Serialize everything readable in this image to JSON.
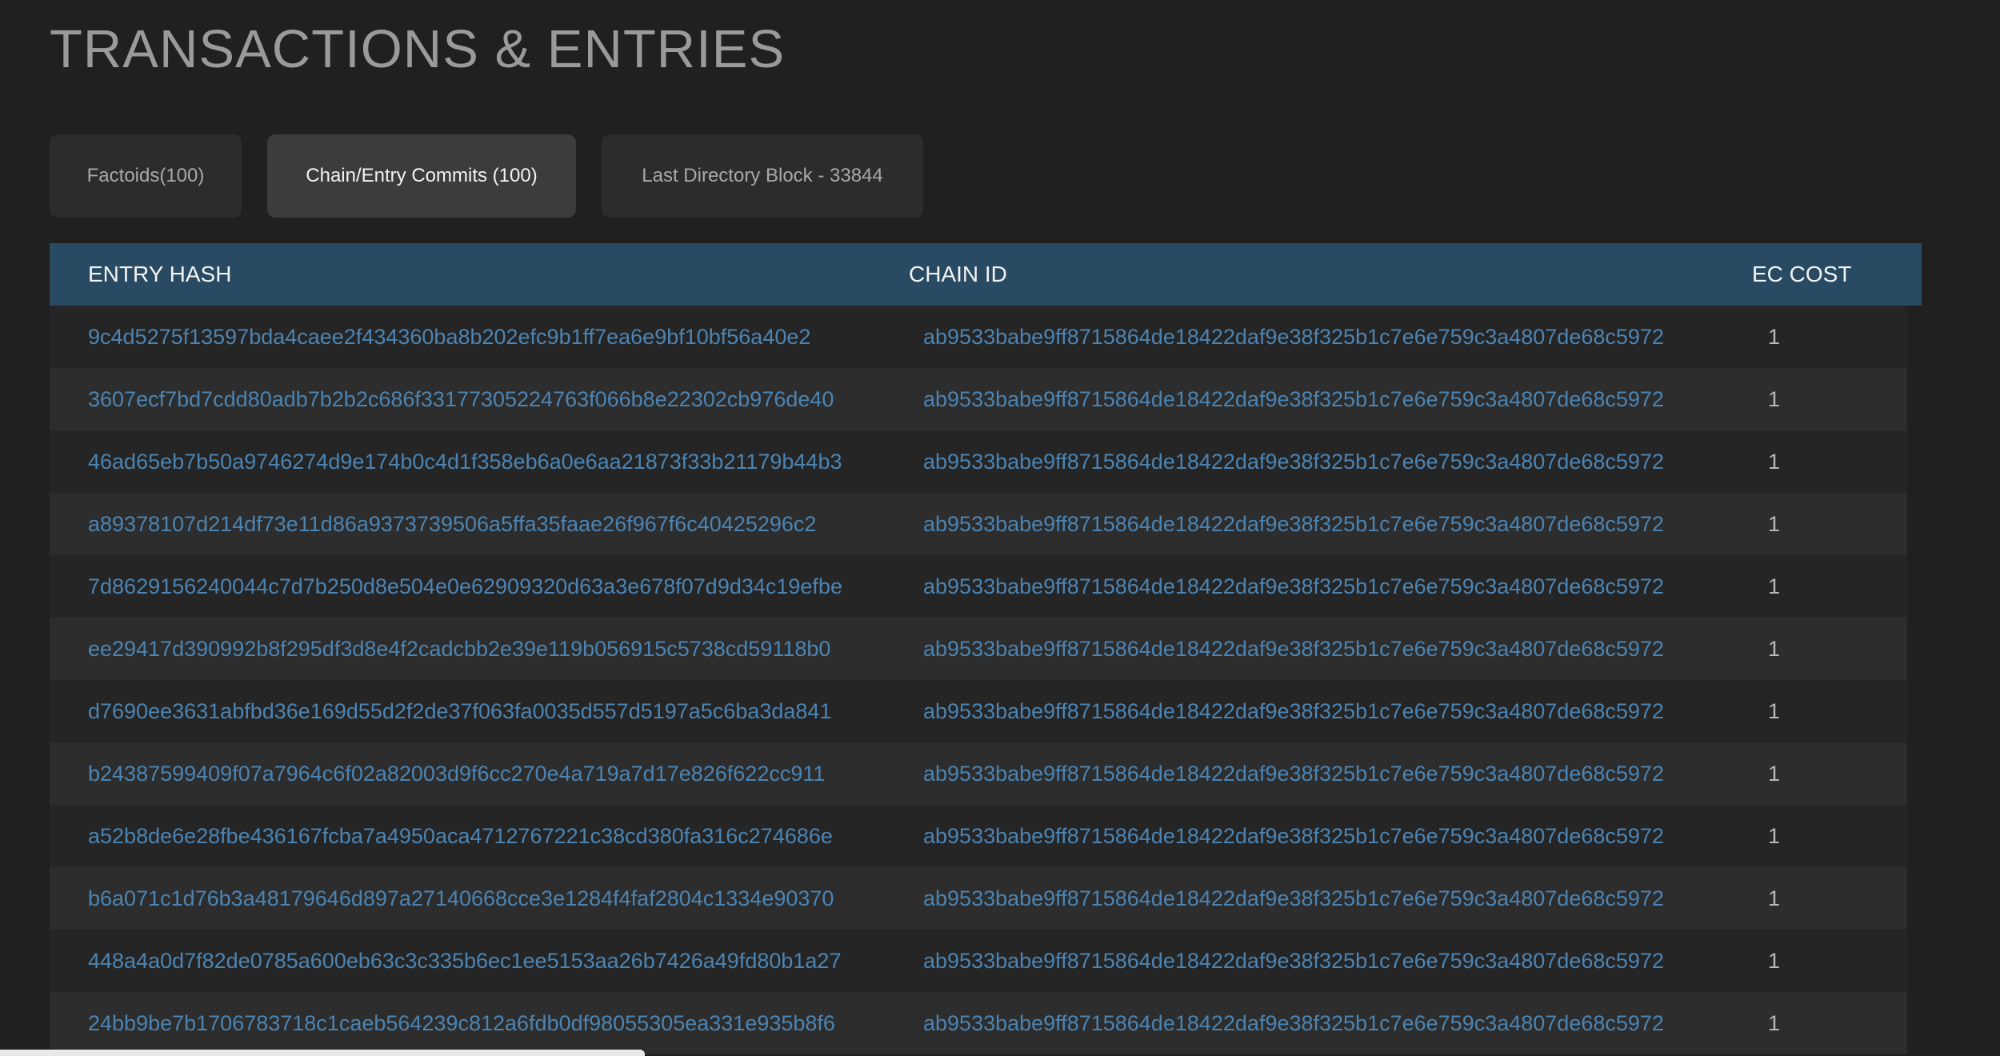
{
  "page": {
    "title": "TRANSACTIONS & ENTRIES"
  },
  "tabs": [
    {
      "label": "Factoids(100)"
    },
    {
      "label": "Chain/Entry Commits (100)",
      "active": true
    },
    {
      "label": "Last Directory Block - 33844"
    }
  ],
  "table": {
    "headers": {
      "entry_hash": "ENTRY HASH",
      "chain_id": "CHAIN ID",
      "ec_cost": "EC COST"
    },
    "rows": [
      {
        "entry_hash": "9c4d5275f13597bda4caee2f434360ba8b202efc9b1ff7ea6e9bf10bf56a40e2",
        "chain_id": "ab9533babe9ff8715864de18422daf9e38f325b1c7e6e759c3a4807de68c5972",
        "ec_cost": "1"
      },
      {
        "entry_hash": "3607ecf7bd7cdd80adb7b2b2c686f33177305224763f066b8e22302cb976de40",
        "chain_id": "ab9533babe9ff8715864de18422daf9e38f325b1c7e6e759c3a4807de68c5972",
        "ec_cost": "1"
      },
      {
        "entry_hash": "46ad65eb7b50a9746274d9e174b0c4d1f358eb6a0e6aa21873f33b21179b44b3",
        "chain_id": "ab9533babe9ff8715864de18422daf9e38f325b1c7e6e759c3a4807de68c5972",
        "ec_cost": "1"
      },
      {
        "entry_hash": "a89378107d214df73e11d86a9373739506a5ffa35faae26f967f6c40425296c2",
        "chain_id": "ab9533babe9ff8715864de18422daf9e38f325b1c7e6e759c3a4807de68c5972",
        "ec_cost": "1"
      },
      {
        "entry_hash": "7d8629156240044c7d7b250d8e504e0e62909320d63a3e678f07d9d34c19efbe",
        "chain_id": "ab9533babe9ff8715864de18422daf9e38f325b1c7e6e759c3a4807de68c5972",
        "ec_cost": "1"
      },
      {
        "entry_hash": "ee29417d390992b8f295df3d8e4f2cadcbb2e39e119b056915c5738cd59118b0",
        "chain_id": "ab9533babe9ff8715864de18422daf9e38f325b1c7e6e759c3a4807de68c5972",
        "ec_cost": "1"
      },
      {
        "entry_hash": "d7690ee3631abfbd36e169d55d2f2de37f063fa0035d557d5197a5c6ba3da841",
        "chain_id": "ab9533babe9ff8715864de18422daf9e38f325b1c7e6e759c3a4807de68c5972",
        "ec_cost": "1"
      },
      {
        "entry_hash": "b24387599409f07a7964c6f02a82003d9f6cc270e4a719a7d17e826f622cc911",
        "chain_id": "ab9533babe9ff8715864de18422daf9e38f325b1c7e6e759c3a4807de68c5972",
        "ec_cost": "1"
      },
      {
        "entry_hash": "a52b8de6e28fbe436167fcba7a4950aca4712767221c38cd380fa316c274686e",
        "chain_id": "ab9533babe9ff8715864de18422daf9e38f325b1c7e6e759c3a4807de68c5972",
        "ec_cost": "1"
      },
      {
        "entry_hash": "b6a071c1d76b3a48179646d897a27140668cce3e1284f4faf2804c1334e90370",
        "chain_id": "ab9533babe9ff8715864de18422daf9e38f325b1c7e6e759c3a4807de68c5972",
        "ec_cost": "1"
      },
      {
        "entry_hash": "448a4a0d7f82de0785a600eb63c3c335b6ec1ee5153aa26b7426a49fd80b1a27",
        "chain_id": "ab9533babe9ff8715864de18422daf9e38f325b1c7e6e759c3a4807de68c5972",
        "ec_cost": "1"
      },
      {
        "entry_hash": "24bb9be7b1706783718c1caeb564239c812a6fdb0df98055305ea331e935b8f6",
        "chain_id": "ab9533babe9ff8715864de18422daf9e38f325b1c7e6e759c3a4807de68c5972",
        "ec_cost": "1"
      }
    ]
  },
  "colors": {
    "background": "#202020",
    "header_bar": "#284a63",
    "link": "#4b84b3",
    "tab_active": "#3c3c3c",
    "tab_inactive": "#2c2c2c"
  }
}
